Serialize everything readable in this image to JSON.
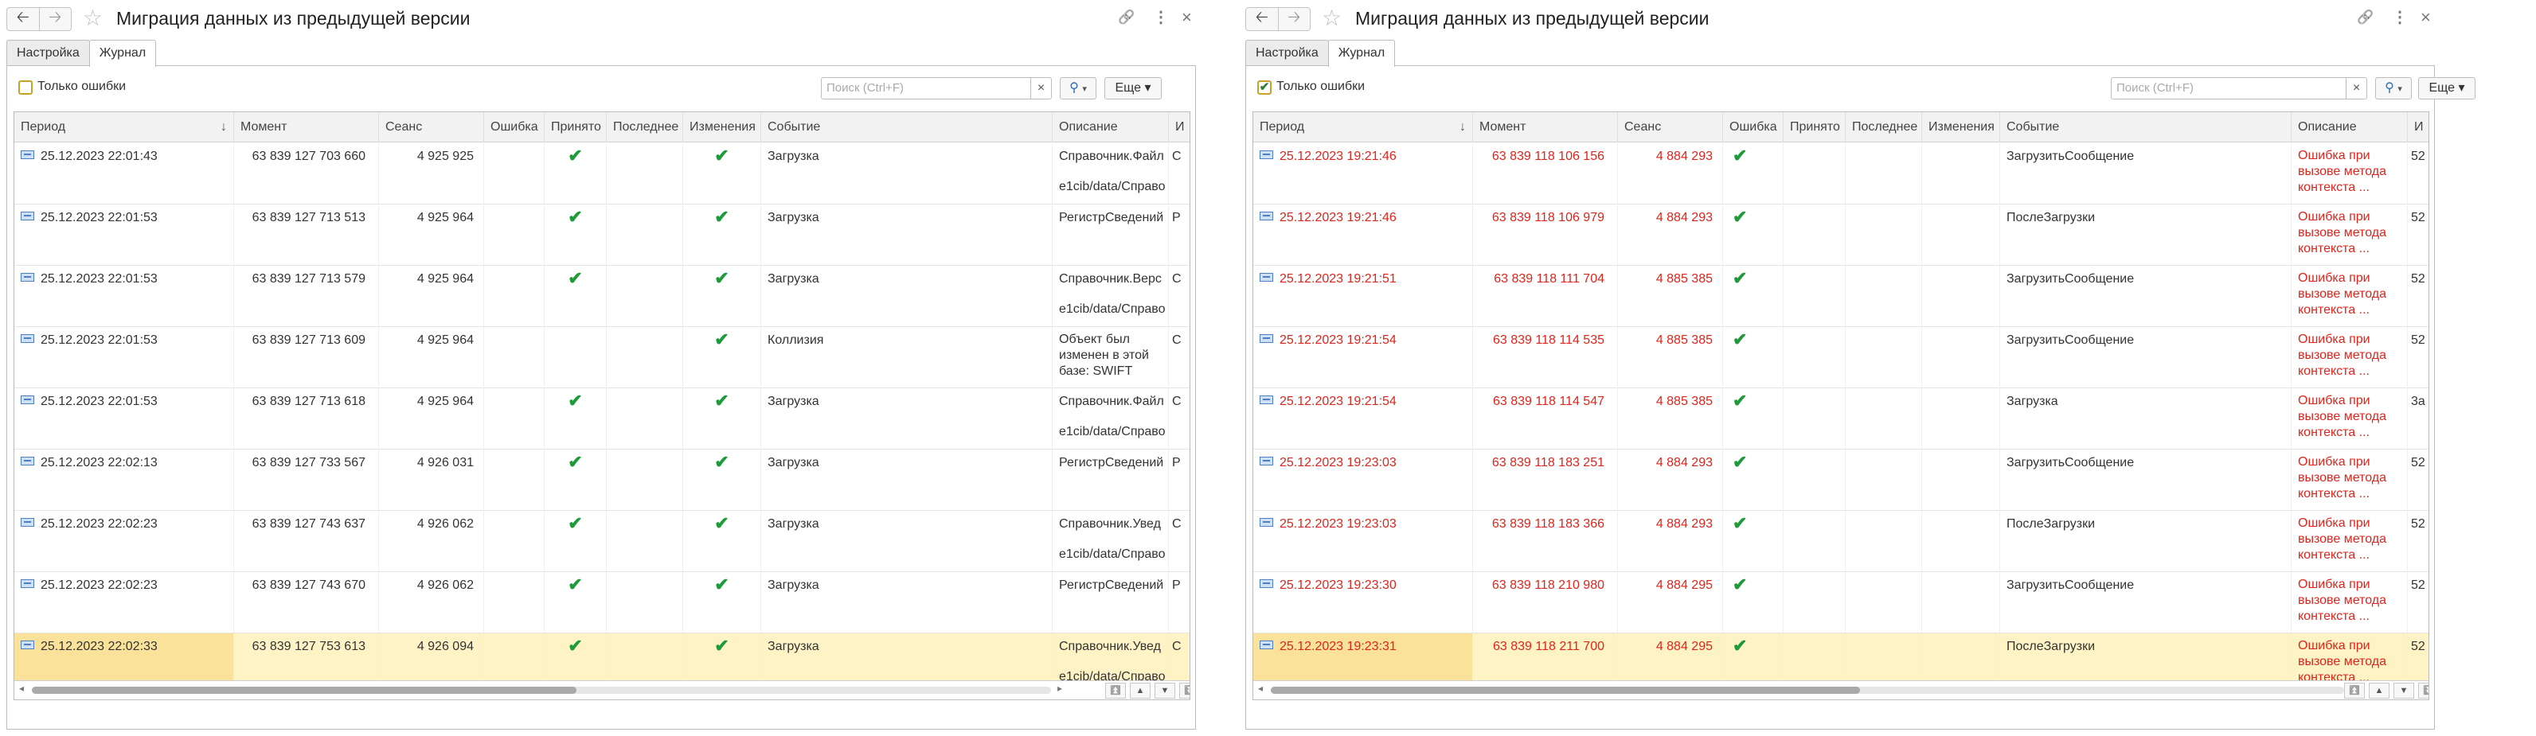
{
  "left": {
    "window_title": "Миграция данных из предыдущей версии",
    "tabs": [
      "Настройка",
      "Журнал"
    ],
    "active_tab": "Журнал",
    "filter": {
      "only_errors_label": "Только ошибки",
      "only_errors_checked": false
    },
    "search_placeholder": "Поиск (Ctrl+F)",
    "search_clear": "×",
    "search_button": "🔍 ▾",
    "more_button": "Еще ▾",
    "columns": [
      "Период",
      "Момент",
      "Сеанс",
      "Ошибка",
      "Принято",
      "Последнее",
      "Изменения",
      "Событие",
      "Описание",
      "И"
    ],
    "sort_indicator": "↓",
    "rows": [
      {
        "period": "25.12.2023 22:01:43",
        "moment": "63 839 127 703 660",
        "session": "4 925 925",
        "error": "",
        "accepted": "✔",
        "last": "",
        "changes": "✔",
        "event": "Загрузка",
        "desc1": "Справочник.Файл",
        "desc2": "e1cib/data/Справо",
        "extra": "С"
      },
      {
        "period": "25.12.2023 22:01:53",
        "moment": "63 839 127 713 513",
        "session": "4 925 964",
        "error": "",
        "accepted": "✔",
        "last": "",
        "changes": "✔",
        "event": "Загрузка",
        "desc1": "РегистрСведений",
        "desc2": "",
        "extra": "Р"
      },
      {
        "period": "25.12.2023 22:01:53",
        "moment": "63 839 127 713 579",
        "session": "4 925 964",
        "error": "",
        "accepted": "✔",
        "last": "",
        "changes": "✔",
        "event": "Загрузка",
        "desc1": "Справочник.Верс",
        "desc2": "e1cib/data/Справо",
        "extra": "С"
      },
      {
        "period": "25.12.2023 22:01:53",
        "moment": "63 839 127 713 609",
        "session": "4 925 964",
        "error": "",
        "accepted": "",
        "last": "",
        "changes": "✔",
        "event": "Коллизия",
        "desc_wrap": "Объект был изменен в этой базе: SWIFT",
        "desc1": "",
        "desc2": "",
        "extra": "С"
      },
      {
        "period": "25.12.2023 22:01:53",
        "moment": "63 839 127 713 618",
        "session": "4 925 964",
        "error": "",
        "accepted": "✔",
        "last": "",
        "changes": "✔",
        "event": "Загрузка",
        "desc1": "Справочник.Файл",
        "desc2": "e1cib/data/Справо",
        "extra": "С"
      },
      {
        "period": "25.12.2023 22:02:13",
        "moment": "63 839 127 733 567",
        "session": "4 926 031",
        "error": "",
        "accepted": "✔",
        "last": "",
        "changes": "✔",
        "event": "Загрузка",
        "desc1": "РегистрСведений",
        "desc2": "",
        "extra": "Р"
      },
      {
        "period": "25.12.2023 22:02:23",
        "moment": "63 839 127 743 637",
        "session": "4 926 062",
        "error": "",
        "accepted": "✔",
        "last": "",
        "changes": "✔",
        "event": "Загрузка",
        "desc1": "Справочник.Увед",
        "desc2": "e1cib/data/Справо",
        "extra": "С"
      },
      {
        "period": "25.12.2023 22:02:23",
        "moment": "63 839 127 743 670",
        "session": "4 926 062",
        "error": "",
        "accepted": "✔",
        "last": "",
        "changes": "✔",
        "event": "Загрузка",
        "desc1": "РегистрСведений",
        "desc2": "",
        "extra": "Р"
      },
      {
        "period": "25.12.2023 22:02:33",
        "moment": "63 839 127 753 613",
        "session": "4 926 094",
        "error": "",
        "accepted": "✔",
        "last": "",
        "changes": "✔",
        "event": "Загрузка",
        "desc1": "Справочник.Увед",
        "desc2": "e1cib/data/Справо",
        "extra": "С",
        "selected": true
      }
    ]
  },
  "right": {
    "window_title": "Миграция данных из предыдущей версии",
    "tabs": [
      "Настройка",
      "Журнал"
    ],
    "active_tab": "Журнал",
    "filter": {
      "only_errors_label": "Только ошибки",
      "only_errors_checked": true
    },
    "search_placeholder": "Поиск (Ctrl+F)",
    "search_clear": "×",
    "search_button": "🔍 ▾",
    "more_button": "Еще ▾",
    "columns": [
      "Период",
      "Момент",
      "Сеанс",
      "Ошибка",
      "Принято",
      "Последнее",
      "Изменения",
      "Событие",
      "Описание",
      "И"
    ],
    "sort_indicator": "↓",
    "rows": [
      {
        "period": "25.12.2023 19:21:46",
        "moment": "63 839 118 106 156",
        "session": "4 884 293",
        "error": "✔",
        "accepted": "",
        "last": "",
        "changes": "",
        "event": "ЗагрузитьСообщение",
        "desc_wrap": "Ошибка при вызове метода контекста ...",
        "extra": "52"
      },
      {
        "period": "25.12.2023 19:21:46",
        "moment": "63 839 118 106 979",
        "session": "4 884 293",
        "error": "✔",
        "accepted": "",
        "last": "",
        "changes": "",
        "event": "ПослеЗагрузки",
        "desc_wrap": "Ошибка при вызове метода контекста ...",
        "extra": "52"
      },
      {
        "period": "25.12.2023 19:21:51",
        "moment": "63 839 118 111 704",
        "session": "4 885 385",
        "error": "✔",
        "accepted": "",
        "last": "",
        "changes": "",
        "event": "ЗагрузитьСообщение",
        "desc_wrap": "Ошибка при вызове метода контекста ...",
        "extra": "52"
      },
      {
        "period": "25.12.2023 19:21:54",
        "moment": "63 839 118 114 535",
        "session": "4 885 385",
        "error": "✔",
        "accepted": "",
        "last": "",
        "changes": "",
        "event": "ЗагрузитьСообщение",
        "desc_wrap": "Ошибка при вызове метода контекста ...",
        "extra": "52"
      },
      {
        "period": "25.12.2023 19:21:54",
        "moment": "63 839 118 114 547",
        "session": "4 885 385",
        "error": "✔",
        "accepted": "",
        "last": "",
        "changes": "",
        "event": "Загрузка",
        "desc_wrap": "Ошибка при вызове метода контекста ...",
        "extra": "3a"
      },
      {
        "period": "25.12.2023 19:23:03",
        "moment": "63 839 118 183 251",
        "session": "4 884 293",
        "error": "✔",
        "accepted": "",
        "last": "",
        "changes": "",
        "event": "ЗагрузитьСообщение",
        "desc_wrap": "Ошибка при вызове метода контекста ...",
        "extra": "52"
      },
      {
        "period": "25.12.2023 19:23:03",
        "moment": "63 839 118 183 366",
        "session": "4 884 293",
        "error": "✔",
        "accepted": "",
        "last": "",
        "changes": "",
        "event": "ПослеЗагрузки",
        "desc_wrap": "Ошибка при вызове метода контекста ...",
        "extra": "52"
      },
      {
        "period": "25.12.2023 19:23:30",
        "moment": "63 839 118 210 980",
        "session": "4 884 295",
        "error": "✔",
        "accepted": "",
        "last": "",
        "changes": "",
        "event": "ЗагрузитьСообщение",
        "desc_wrap": "Ошибка при вызове метода контекста ...",
        "extra": "52"
      },
      {
        "period": "25.12.2023 19:23:31",
        "moment": "63 839 118 211 700",
        "session": "4 884 295",
        "error": "✔",
        "accepted": "",
        "last": "",
        "changes": "",
        "event": "ПослеЗагрузки",
        "desc_wrap": "Ошибка при вызове метода контекста ...",
        "extra": "52",
        "selected": true
      }
    ]
  }
}
